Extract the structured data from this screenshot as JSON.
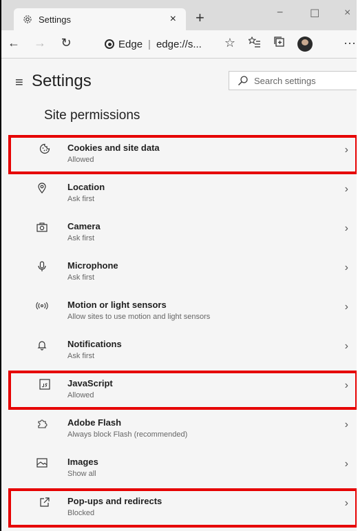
{
  "browser": {
    "tab_title": "Settings",
    "tab_close": "×",
    "new_tab": "+",
    "win_minimize": "−",
    "win_maximize": "☐",
    "win_close": "×",
    "address_brand": "Edge",
    "address_separator": "|",
    "address_url": "edge://s...",
    "more": "···"
  },
  "settings": {
    "title": "Settings",
    "search_placeholder": "Search settings",
    "section_title": "Site permissions"
  },
  "permissions": [
    {
      "label": "Cookies and site data",
      "sub": "Allowed",
      "icon": "cookie-icon",
      "highlighted": true
    },
    {
      "label": "Location",
      "sub": "Ask first",
      "icon": "location-pin-icon",
      "highlighted": false
    },
    {
      "label": "Camera",
      "sub": "Ask first",
      "icon": "camera-icon",
      "highlighted": false
    },
    {
      "label": "Microphone",
      "sub": "Ask first",
      "icon": "microphone-icon",
      "highlighted": false
    },
    {
      "label": "Motion or light sensors",
      "sub": "Allow sites to use motion and light sensors",
      "icon": "sensor-icon",
      "highlighted": false
    },
    {
      "label": "Notifications",
      "sub": "Ask first",
      "icon": "bell-icon",
      "highlighted": false
    },
    {
      "label": "JavaScript",
      "sub": "Allowed",
      "icon": "javascript-icon",
      "highlighted": true
    },
    {
      "label": "Adobe Flash",
      "sub": "Always block Flash (recommended)",
      "icon": "puzzle-icon",
      "highlighted": false
    },
    {
      "label": "Images",
      "sub": "Show all",
      "icon": "image-icon",
      "highlighted": false
    },
    {
      "label": "Pop-ups and redirects",
      "sub": "Blocked",
      "icon": "external-link-icon",
      "highlighted": true
    }
  ],
  "colors": {
    "highlight": "#e60000",
    "background": "#f5f5f5"
  }
}
